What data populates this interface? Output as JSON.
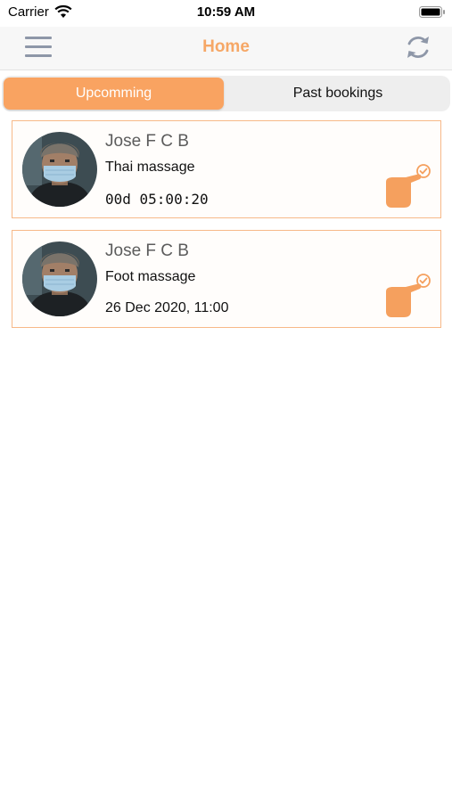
{
  "status_bar": {
    "carrier": "Carrier",
    "time": "10:59 AM"
  },
  "nav": {
    "title": "Home",
    "menu_icon": "hamburger-menu-icon",
    "refresh_icon": "refresh-icon"
  },
  "tabs": [
    {
      "label": "Upcomming",
      "active": true
    },
    {
      "label": "Past bookings",
      "active": false
    }
  ],
  "bookings": [
    {
      "name": "Jose F C B",
      "service": "Thai massage",
      "countdown": "00d 05:00:20"
    },
    {
      "name": "Jose F C B",
      "service": "Foot massage",
      "datetime": "26 Dec 2020, 11:00"
    }
  ],
  "colors": {
    "accent": "#f9a361",
    "title": "#f6a766",
    "card_border": "#f7b988",
    "icon_gray": "#8e97a8"
  }
}
